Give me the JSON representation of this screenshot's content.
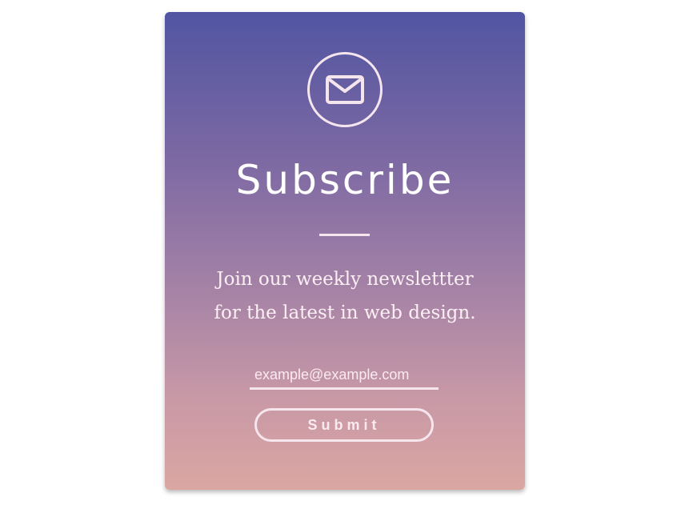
{
  "subscribe_card": {
    "icon": "envelope-icon",
    "title": "Subscribe",
    "description_line1": "Join our weekly newslettter",
    "description_line2": "for the latest in web design.",
    "email_placeholder": "example@example.com",
    "submit_label": "Submit"
  },
  "colors": {
    "gradient_top": "#5155a2",
    "gradient_bottom": "#dba6a2",
    "foreground": "#f5e6ee"
  }
}
